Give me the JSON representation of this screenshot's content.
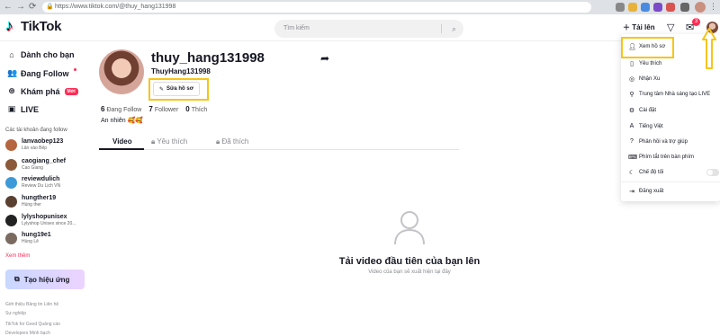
{
  "browser": {
    "url": "https://www.tiktok.com/@thuy_hang131998"
  },
  "header": {
    "logo": "TikTok",
    "search_placeholder": "Tìm kiếm",
    "upload_label": "Tải lên",
    "notification_count": "3"
  },
  "sidebar": {
    "nav": [
      {
        "label": "Dành cho bạn",
        "icon": "home-icon"
      },
      {
        "label": "Đang Follow",
        "icon": "people-icon"
      },
      {
        "label": "Khám phá",
        "icon": "compass-icon",
        "badge": "Mới"
      },
      {
        "label": "LIVE",
        "icon": "live-icon"
      }
    ],
    "following_title": "Các tài khoản đang follow",
    "following": [
      {
        "name": "lanvaobep123",
        "sub": "Lân vào Bếp",
        "color": "#b5653f"
      },
      {
        "name": "caogiang_chef",
        "sub": "Cao Giang",
        "color": "#8c5a3a"
      },
      {
        "name": "reviewdulich",
        "sub": "Review Du Lịch VN",
        "color": "#3d9ad8"
      },
      {
        "name": "hungther19",
        "sub": "Hùng ther",
        "color": "#5a4030"
      },
      {
        "name": "lylyshopunisex",
        "sub": "Lylyshop Unisex since 20...",
        "color": "#222222"
      },
      {
        "name": "hung19e1",
        "sub": "Hùng Lê",
        "color": "#7a6a60"
      }
    ],
    "see_more": "Xem thêm",
    "effect_button": "Tạo hiệu ứng",
    "footer": [
      "Giới thiệu   Bảng tin   Liên hệ",
      "Sự nghiệp",
      "TikTok for Good   Quảng cáo",
      "Developers   Minh bạch"
    ]
  },
  "profile": {
    "display_name": "thuy_hang131998",
    "username": "ThuyHang131998",
    "edit_label": "Sửa hồ sơ",
    "following_count": "6",
    "following_label": "Đang Follow",
    "followers_count": "7",
    "followers_label": "Follower",
    "likes_count": "0",
    "likes_label": "Thích",
    "bio": "An nhiên 🥰🥰",
    "tabs": [
      "Video",
      "Yêu thích",
      "Đã thích"
    ],
    "empty_title": "Tải video đầu tiên của bạn lên",
    "empty_subtitle": "Video của bạn sẽ xuất hiện tại đây"
  },
  "menu": {
    "items": [
      {
        "label": "Xem hồ sơ",
        "icon": "user-icon"
      },
      {
        "label": "Yêu thích",
        "icon": "bookmark-icon"
      },
      {
        "label": "Nhận Xu",
        "icon": "coin-icon"
      },
      {
        "label": "Trung tâm Nhà sáng tạo LIVE",
        "icon": "bulb-icon"
      },
      {
        "label": "Cài đặt",
        "icon": "gear-icon"
      },
      {
        "label": "Tiếng Việt",
        "icon": "language-icon"
      },
      {
        "label": "Phản hồi và trợ giúp",
        "icon": "help-icon"
      },
      {
        "label": "Phím tắt trên bàn phím",
        "icon": "keyboard-icon"
      },
      {
        "label": "Chế độ tối",
        "icon": "moon-icon"
      },
      {
        "label": "Đăng xuất",
        "icon": "logout-icon"
      }
    ]
  },
  "colors": {
    "accent": "#fe2c55",
    "highlight": "#f5c518"
  }
}
